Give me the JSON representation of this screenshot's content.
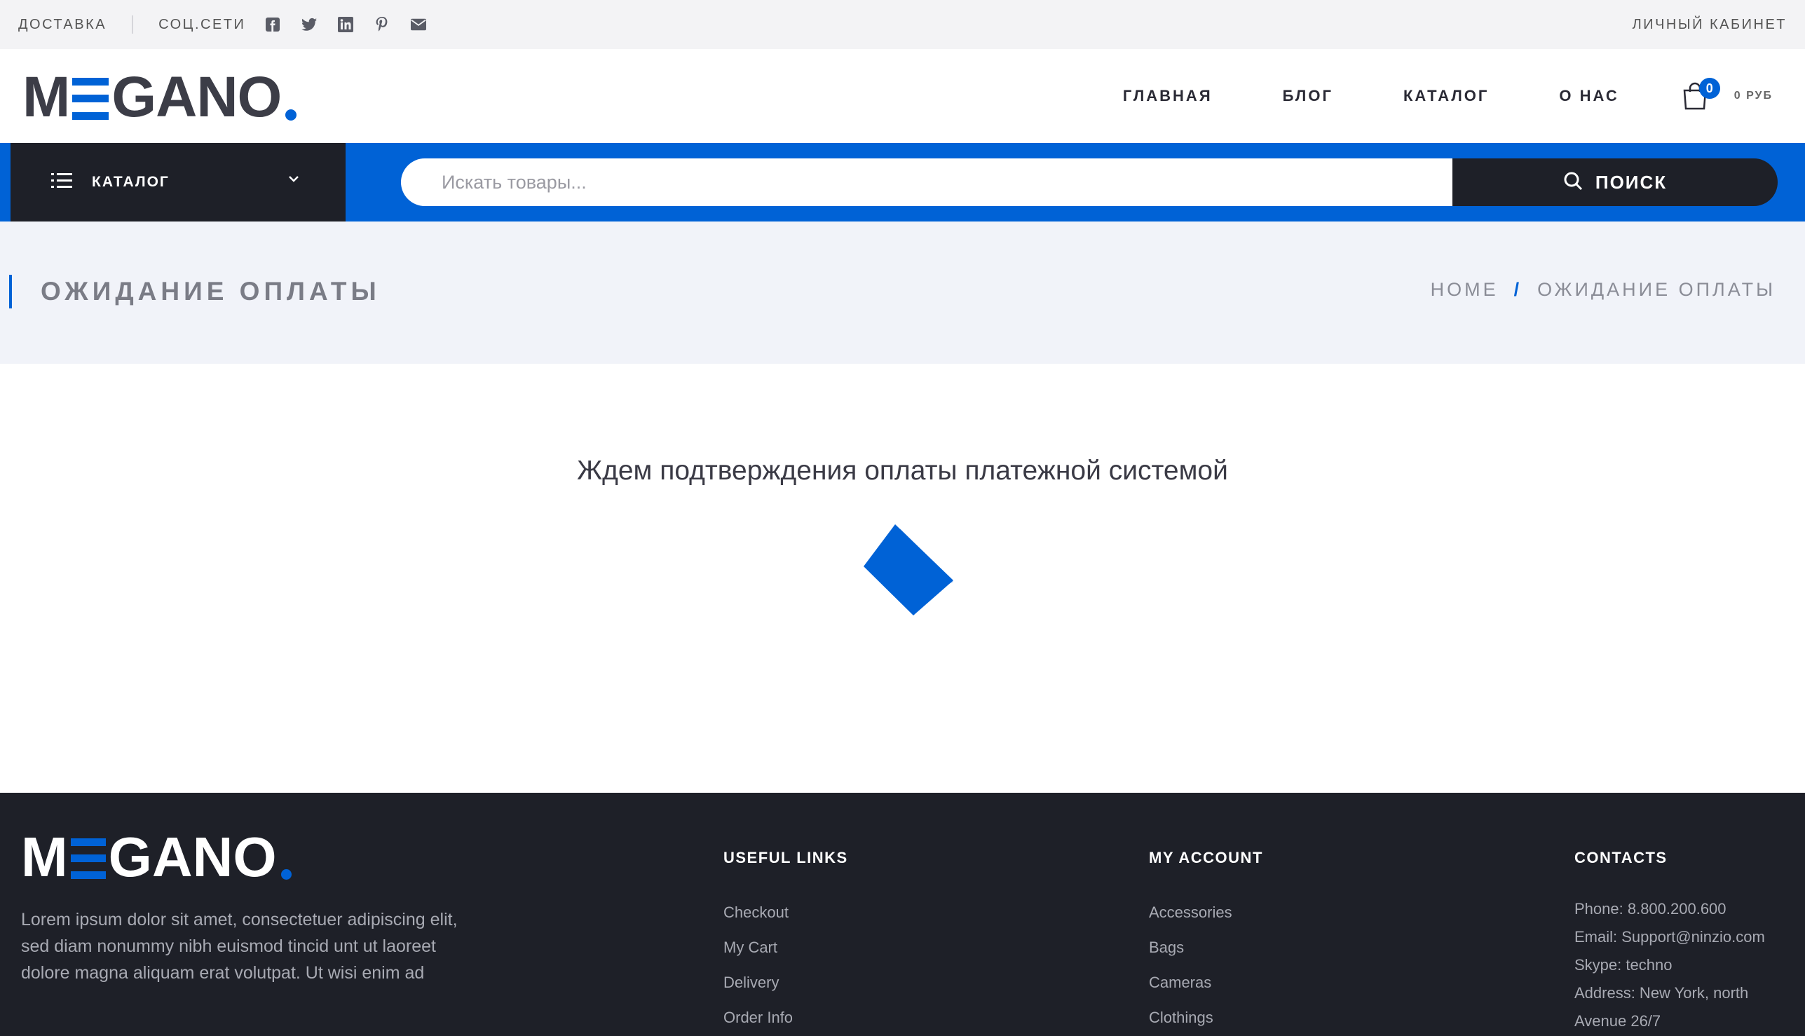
{
  "topbar": {
    "delivery": "ДОСТАВКА",
    "social_label": "СОЦ.СЕТИ",
    "social_icons": [
      "facebook-icon",
      "twitter-icon",
      "linkedin-icon",
      "pinterest-icon",
      "mail-icon"
    ],
    "account": "ЛИЧНЫЙ КАБИНЕТ"
  },
  "brand": {
    "logo_prefix": "M",
    "logo_suffix": "GANO",
    "accent_color": "#0062d6",
    "dark_color": "#1e2028"
  },
  "nav": {
    "items": [
      "ГЛАВНАЯ",
      "БЛОГ",
      "КАТАЛОГ",
      "О НАС"
    ]
  },
  "cart": {
    "count": "0",
    "total": "0 РУБ"
  },
  "searchbar": {
    "catalog_label": "КАТАЛОГ",
    "placeholder": "Искать товары...",
    "search_label": "ПОИСК"
  },
  "page": {
    "title": "ОЖИДАНИЕ ОПЛАТЫ",
    "breadcrumb": {
      "home": "HOME",
      "separator": "/",
      "current": "ОЖИДАНИЕ ОПЛАТЫ"
    },
    "message": "Ждем подтверждения оплаты платежной системой"
  },
  "footer": {
    "about": "Lorem ipsum dolor sit amet, consectetuer adipiscing elit, sed diam nonummy nibh euismod tincid unt ut laoreet dolore magna aliquam erat volutpat. Ut wisi enim ad",
    "useful_links": {
      "title": "USEFUL LINKS",
      "items": [
        "Checkout",
        "My Cart",
        "Delivery",
        "Order Info"
      ]
    },
    "my_account": {
      "title": "MY ACCOUNT",
      "items": [
        "Accessories",
        "Bags",
        "Cameras",
        "Clothings"
      ]
    },
    "contacts": {
      "title": "CONTACTS",
      "phone": "Phone: 8.800.200.600",
      "email": "Email: Support@ninzio.com",
      "skype": "Skype: techno",
      "address_line1": "Address: New York, north",
      "address_line2": "Avenue 26/7"
    }
  }
}
